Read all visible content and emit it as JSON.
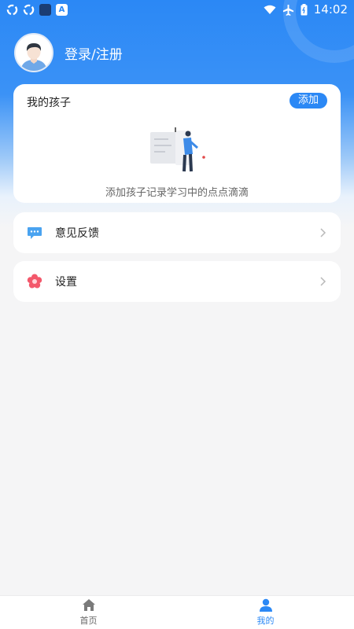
{
  "status_bar": {
    "time": "14:02",
    "left_icons": [
      "sync-icon",
      "sync-icon",
      "app-square-icon",
      "a-square-icon"
    ],
    "right_icons": [
      "wifi-icon",
      "airplane-icon",
      "battery-icon"
    ]
  },
  "profile": {
    "login_label": "登录/注册"
  },
  "kids_card": {
    "title": "我的孩子",
    "add_label": "添加",
    "empty_text": "添加孩子记录学习中的点点滴滴"
  },
  "menu": {
    "feedback_label": "意见反馈",
    "settings_label": "设置"
  },
  "tabbar": {
    "home_label": "首页",
    "mine_label": "我的",
    "active": "mine"
  },
  "colors": {
    "brand": "#2b88f5",
    "background": "#f5f5f6",
    "feedback_icon": "#4aa3f0",
    "settings_icon": "#f3586b"
  }
}
